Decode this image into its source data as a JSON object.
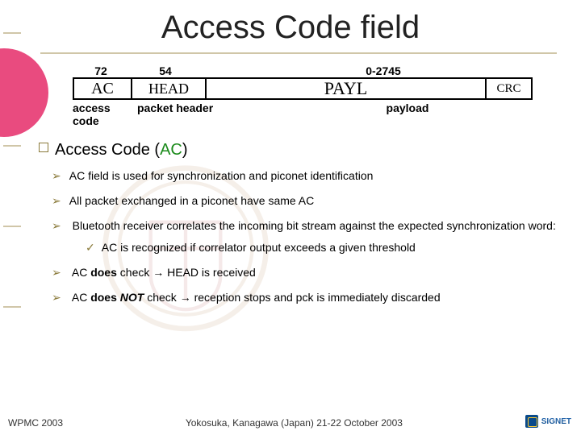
{
  "title": "Access Code field",
  "packet": {
    "bits": {
      "ac": "72",
      "head": "54",
      "payl": "0-2745"
    },
    "boxes": {
      "ac": "AC",
      "head": "HEAD",
      "payl": "PAYL",
      "crc": "CRC"
    },
    "labels": {
      "ac": "access code",
      "head": "packet header",
      "payl": "payload"
    }
  },
  "section": {
    "heading_prefix": "Access Code (",
    "heading_ac": "AC",
    "heading_suffix": ")"
  },
  "bullets": {
    "b1": "AC field is used for synchronization and piconet identification",
    "b2": "All packet exchanged in a piconet have same AC",
    "b3": "Bluetooth receiver correlates the incoming bit stream against the expected synchronization word:",
    "b3a": "AC is recognized if correlator output exceeds a given threshold",
    "b4_pre": "AC ",
    "b4_does": "does",
    "b4_mid": " check ",
    "b4_arrow": "→",
    "b4_post": " HEAD is received",
    "b5_pre": "AC ",
    "b5_does": "does ",
    "b5_not": "NOT",
    "b5_mid": " check ",
    "b5_arrow": "→",
    "b5_post": " reception stops and pck is immediately discarded"
  },
  "footer": {
    "left": "WPMC 2003",
    "center": "Yokosuka, Kanagawa (Japan) 21-22 October 2003",
    "logo": "SIGNET"
  }
}
